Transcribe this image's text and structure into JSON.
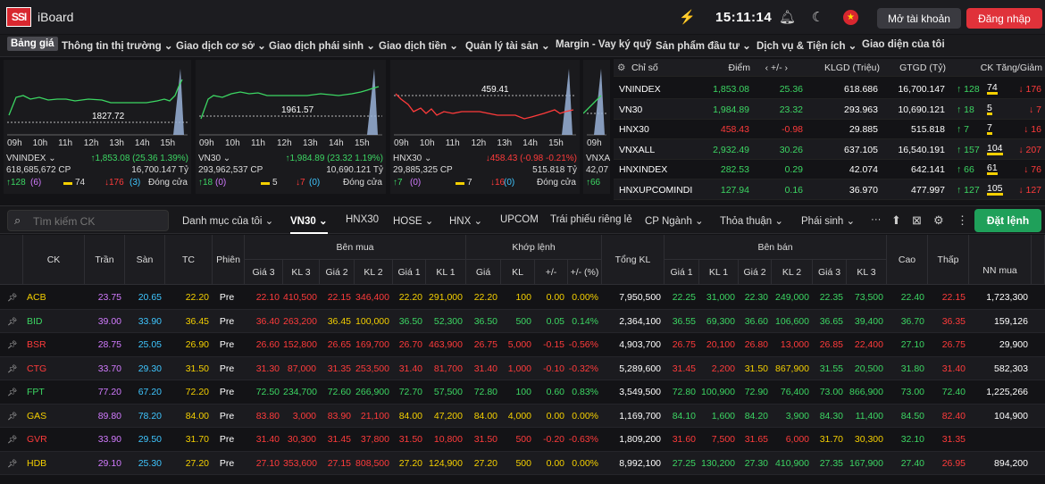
{
  "app": {
    "logo": "SSI",
    "name": "iBoard",
    "time": "15:11:14",
    "open_account": "Mở tài khoản",
    "login": "Đăng nhập"
  },
  "menu": [
    "Bảng giá",
    "Thông tin thị trường ⌄",
    "Giao dịch cơ sở ⌄",
    "Giao dịch phái sinh ⌄",
    "Giao dịch tiền ⌄",
    "Quản lý tài sản ⌄",
    "Margin - Vay ký quỹ",
    "Sản phẩm đầu tư ⌄",
    "Dịch vụ & Tiện ích ⌄",
    "Giao diện của tôi"
  ],
  "charts": [
    {
      "name": "VNINDEX ⌄",
      "ref": "1827.72",
      "volume": "618,685,672 CP",
      "change": "↑1,853.08 (25.36 1.39%)",
      "value": "16,700.147 Tỷ",
      "up": "↑128",
      "up_n": "(6)",
      "flat": "74",
      "down": "↓176",
      "down_n": "(3)",
      "status": "Đóng cửa",
      "hours": [
        "09h",
        "10h",
        "11h",
        "12h",
        "13h",
        "14h",
        "15h"
      ]
    },
    {
      "name": "VN30 ⌄",
      "ref": "1961.57",
      "volume": "293,962,537 CP",
      "change": "↑1,984.89 (23.32 1.19%)",
      "value": "10,690.121 Tỷ",
      "up": "↑18",
      "up_n": "(0)",
      "flat": "5",
      "down": "↓7",
      "down_n": "(0)",
      "status": "Đóng cửa",
      "hours": [
        "09h",
        "10h",
        "11h",
        "12h",
        "13h",
        "14h",
        "15h"
      ]
    },
    {
      "name": "HNX30 ⌄",
      "ref": "459.41",
      "volume": "29,885,325 CP",
      "change": "↓458.43 (-0.98 -0.21%)",
      "value": "515.818 Tỷ",
      "up": "↑7",
      "up_n": "(0)",
      "flat": "7",
      "down": "↓16",
      "down_n": "(0)",
      "status": "Đóng cửa",
      "hours": [
        "09h",
        "10h",
        "11h",
        "12h",
        "13h",
        "14h",
        "15h"
      ]
    },
    {
      "name": "VNXA",
      "ref": "",
      "volume": "42,07",
      "change": "",
      "value": "",
      "up": "↑66",
      "up_n": "",
      "flat": "",
      "down": "",
      "down_n": "",
      "status": "",
      "hours": [
        "09h"
      ]
    }
  ],
  "index_table": {
    "headers": [
      "Chỉ số",
      "Điểm",
      "‹ +/- ›",
      "KLGD (Triệu)",
      "GTGD (Tỷ)",
      "CK Tăng/Giảm"
    ],
    "rows": [
      {
        "name": "VNINDEX",
        "point": "1,853.08",
        "chg": "25.36",
        "vol": "618.686",
        "val": "16,700.147",
        "up": "↑ 128",
        "flat": "74",
        "down": "↓ 176",
        "color": "#3cd663"
      },
      {
        "name": "VN30",
        "point": "1,984.89",
        "chg": "23.32",
        "vol": "293.963",
        "val": "10,690.121",
        "up": "↑ 18",
        "flat": "5",
        "down": "↓ 7",
        "color": "#3cd663"
      },
      {
        "name": "HNX30",
        "point": "458.43",
        "chg": "-0.98",
        "vol": "29.885",
        "val": "515.818",
        "up": "↑ 7",
        "flat": "7",
        "down": "↓ 16",
        "color": "#ff3b3b"
      },
      {
        "name": "VNXALL",
        "point": "2,932.49",
        "chg": "30.26",
        "vol": "637.105",
        "val": "16,540.191",
        "up": "↑ 157",
        "flat": "104",
        "down": "↓ 207",
        "color": "#3cd663"
      },
      {
        "name": "HNXINDEX",
        "point": "282.53",
        "chg": "0.29",
        "vol": "42.074",
        "val": "642.141",
        "up": "↑ 66",
        "flat": "61",
        "down": "↓ 76",
        "color": "#3cd663"
      },
      {
        "name": "HNXUPCOMINDI",
        "point": "127.94",
        "chg": "0.16",
        "vol": "36.970",
        "val": "477.997",
        "up": "↑ 127",
        "flat": "105",
        "down": "↓ 127",
        "color": "#3cd663"
      }
    ]
  },
  "toolbar": {
    "search_placeholder": "Tìm kiếm CK",
    "tabs": [
      "Danh mục của tôi ⌄",
      "VN30 ⌄",
      "HNX30",
      "HOSE ⌄",
      "HNX ⌄",
      "UPCOM",
      "Trái phiếu riêng lẻ",
      "CP Ngành ⌄",
      "Thỏa thuận ⌄",
      "Phái sinh ⌄",
      "···"
    ],
    "order_button": "Đặt lệnh"
  },
  "grid": {
    "groups": {
      "buy": "Bên mua",
      "match": "Khớp lệnh",
      "sell": "Bên bán"
    },
    "headers": {
      "ck": "CK",
      "tran": "Trần",
      "san": "Sàn",
      "tc": "TC",
      "phien": "Phiên",
      "g3": "Giá 3",
      "kl3": "KL 3",
      "g2": "Giá 2",
      "kl2": "KL 2",
      "g1": "Giá 1",
      "kl1": "KL 1",
      "gia": "Giá",
      "kl": "KL",
      "pm": "+/-",
      "pmp": "+/- (%)",
      "tongkl": "Tổng KL",
      "sg1": "Giá 1",
      "skl1": "KL 1",
      "sg2": "Giá 2",
      "skl2": "KL 2",
      "sg3": "Giá 3",
      "skl3": "KL 3",
      "cao": "Cao",
      "thap": "Thấp",
      "nn": "NN mua"
    },
    "rows": [
      {
        "ck": "ACB",
        "tran": "23.75",
        "san": "20.65",
        "tc": "22.20",
        "phien": "Pre",
        "b3": "22.10",
        "bk3": "410,500",
        "b2": "22.15",
        "bk2": "346,400",
        "b1": "22.20",
        "bk1": "291,000",
        "m": "22.20",
        "mk": "100",
        "pm": "0.00",
        "pmp": "0.00%",
        "tkl": "7,950,500",
        "s1": "22.25",
        "sk1": "31,000",
        "s2": "22.30",
        "sk2": "249,000",
        "s3": "22.35",
        "sk3": "73,500",
        "cao": "22.40",
        "thap": "22.15",
        "nn": "1,723,300",
        "col": {
          "ck": "#f5d000",
          "b3": "#ff3b3b",
          "b2": "#ff3b3b",
          "b1": "#f5d000",
          "m": "#f5d000",
          "s1": "#3cd663",
          "s2": "#3cd663",
          "s3": "#3cd663",
          "cao": "#3cd663",
          "thap": "#ff3b3b"
        }
      },
      {
        "ck": "BID",
        "tran": "39.00",
        "san": "33.90",
        "tc": "36.45",
        "phien": "Pre",
        "b3": "36.40",
        "bk3": "263,200",
        "b2": "36.45",
        "bk2": "100,000",
        "b1": "36.50",
        "bk1": "52,300",
        "m": "36.50",
        "mk": "500",
        "pm": "0.05",
        "pmp": "0.14%",
        "tkl": "2,364,100",
        "s1": "36.55",
        "sk1": "69,300",
        "s2": "36.60",
        "sk2": "106,600",
        "s3": "36.65",
        "sk3": "39,400",
        "cao": "36.70",
        "thap": "36.35",
        "nn": "159,126",
        "col": {
          "ck": "#3cd663",
          "b3": "#ff3b3b",
          "b2": "#f5d000",
          "b1": "#3cd663",
          "m": "#3cd663",
          "s1": "#3cd663",
          "s2": "#3cd663",
          "s3": "#3cd663",
          "cao": "#3cd663",
          "thap": "#ff3b3b"
        }
      },
      {
        "ck": "BSR",
        "tran": "28.75",
        "san": "25.05",
        "tc": "26.90",
        "phien": "Pre",
        "b3": "26.60",
        "bk3": "152,800",
        "b2": "26.65",
        "bk2": "169,700",
        "b1": "26.70",
        "bk1": "463,900",
        "m": "26.75",
        "mk": "5,000",
        "pm": "-0.15",
        "pmp": "-0.56%",
        "tkl": "4,903,700",
        "s1": "26.75",
        "sk1": "20,100",
        "s2": "26.80",
        "sk2": "13,000",
        "s3": "26.85",
        "sk3": "22,400",
        "cao": "27.10",
        "thap": "26.75",
        "nn": "29,900",
        "col": {
          "ck": "#ff3b3b",
          "b3": "#ff3b3b",
          "b2": "#ff3b3b",
          "b1": "#ff3b3b",
          "m": "#ff3b3b",
          "s1": "#ff3b3b",
          "s2": "#ff3b3b",
          "s3": "#ff3b3b",
          "cao": "#3cd663",
          "thap": "#ff3b3b"
        }
      },
      {
        "ck": "CTG",
        "tran": "33.70",
        "san": "29.30",
        "tc": "31.50",
        "phien": "Pre",
        "b3": "31.30",
        "bk3": "87,000",
        "b2": "31.35",
        "bk2": "253,500",
        "b1": "31.40",
        "bk1": "81,700",
        "m": "31.40",
        "mk": "1,000",
        "pm": "-0.10",
        "pmp": "-0.32%",
        "tkl": "5,289,600",
        "s1": "31.45",
        "sk1": "2,200",
        "s2": "31.50",
        "sk2": "867,900",
        "s3": "31.55",
        "sk3": "20,500",
        "cao": "31.80",
        "thap": "31.40",
        "nn": "582,303",
        "col": {
          "ck": "#ff3b3b",
          "b3": "#ff3b3b",
          "b2": "#ff3b3b",
          "b1": "#ff3b3b",
          "m": "#ff3b3b",
          "s1": "#ff3b3b",
          "s2": "#f5d000",
          "s3": "#3cd663",
          "cao": "#3cd663",
          "thap": "#ff3b3b"
        }
      },
      {
        "ck": "FPT",
        "tran": "77.20",
        "san": "67.20",
        "tc": "72.20",
        "phien": "Pre",
        "b3": "72.50",
        "bk3": "234,700",
        "b2": "72.60",
        "bk2": "266,900",
        "b1": "72.70",
        "bk1": "57,500",
        "m": "72.80",
        "mk": "100",
        "pm": "0.60",
        "pmp": "0.83%",
        "tkl": "3,549,500",
        "s1": "72.80",
        "sk1": "100,900",
        "s2": "72.90",
        "sk2": "76,400",
        "s3": "73.00",
        "sk3": "866,900",
        "cao": "73.00",
        "thap": "72.40",
        "nn": "1,225,266",
        "col": {
          "ck": "#3cd663",
          "b3": "#3cd663",
          "b2": "#3cd663",
          "b1": "#3cd663",
          "m": "#3cd663",
          "s1": "#3cd663",
          "s2": "#3cd663",
          "s3": "#3cd663",
          "cao": "#3cd663",
          "thap": "#3cd663"
        }
      },
      {
        "ck": "GAS",
        "tran": "89.80",
        "san": "78.20",
        "tc": "84.00",
        "phien": "Pre",
        "b3": "83.80",
        "bk3": "3,000",
        "b2": "83.90",
        "bk2": "21,100",
        "b1": "84.00",
        "bk1": "47,200",
        "m": "84.00",
        "mk": "4,000",
        "pm": "0.00",
        "pmp": "0.00%",
        "tkl": "1,169,700",
        "s1": "84.10",
        "sk1": "1,600",
        "s2": "84.20",
        "sk2": "3,900",
        "s3": "84.30",
        "sk3": "11,400",
        "cao": "84.50",
        "thap": "82.40",
        "nn": "104,900",
        "col": {
          "ck": "#f5d000",
          "b3": "#ff3b3b",
          "b2": "#ff3b3b",
          "b1": "#f5d000",
          "m": "#f5d000",
          "s1": "#3cd663",
          "s2": "#3cd663",
          "s3": "#3cd663",
          "cao": "#3cd663",
          "thap": "#ff3b3b"
        }
      },
      {
        "ck": "GVR",
        "tran": "33.90",
        "san": "29.50",
        "tc": "31.70",
        "phien": "Pre",
        "b3": "31.40",
        "bk3": "30,300",
        "b2": "31.45",
        "bk2": "37,800",
        "b1": "31.50",
        "bk1": "10,800",
        "m": "31.50",
        "mk": "500",
        "pm": "-0.20",
        "pmp": "-0.63%",
        "tkl": "1,809,200",
        "s1": "31.60",
        "sk1": "7,500",
        "s2": "31.65",
        "sk2": "6,000",
        "s3": "31.70",
        "sk3": "30,300",
        "cao": "32.10",
        "thap": "31.35",
        "nn": "",
        "col": {
          "ck": "#ff3b3b",
          "b3": "#ff3b3b",
          "b2": "#ff3b3b",
          "b1": "#ff3b3b",
          "m": "#ff3b3b",
          "s1": "#ff3b3b",
          "s2": "#ff3b3b",
          "s3": "#f5d000",
          "cao": "#3cd663",
          "thap": "#ff3b3b"
        }
      },
      {
        "ck": "HDB",
        "tran": "29.10",
        "san": "25.30",
        "tc": "27.20",
        "phien": "Pre",
        "b3": "27.10",
        "bk3": "353,600",
        "b2": "27.15",
        "bk2": "808,500",
        "b1": "27.20",
        "bk1": "124,900",
        "m": "27.20",
        "mk": "500",
        "pm": "0.00",
        "pmp": "0.00%",
        "tkl": "8,992,100",
        "s1": "27.25",
        "sk1": "130,200",
        "s2": "27.30",
        "sk2": "410,900",
        "s3": "27.35",
        "sk3": "167,900",
        "cao": "27.40",
        "thap": "26.95",
        "nn": "894,200",
        "col": {
          "ck": "#f5d000",
          "b3": "#ff3b3b",
          "b2": "#ff3b3b",
          "b1": "#f5d000",
          "m": "#f5d000",
          "s1": "#3cd663",
          "s2": "#3cd663",
          "s3": "#3cd663",
          "cao": "#3cd663",
          "thap": "#ff3b3b"
        }
      }
    ]
  },
  "colors": {
    "up": "#3cd663",
    "down": "#ff3b3b",
    "ref": "#f5d000",
    "ceil": "#d27bff",
    "floor": "#3fc6ff"
  }
}
